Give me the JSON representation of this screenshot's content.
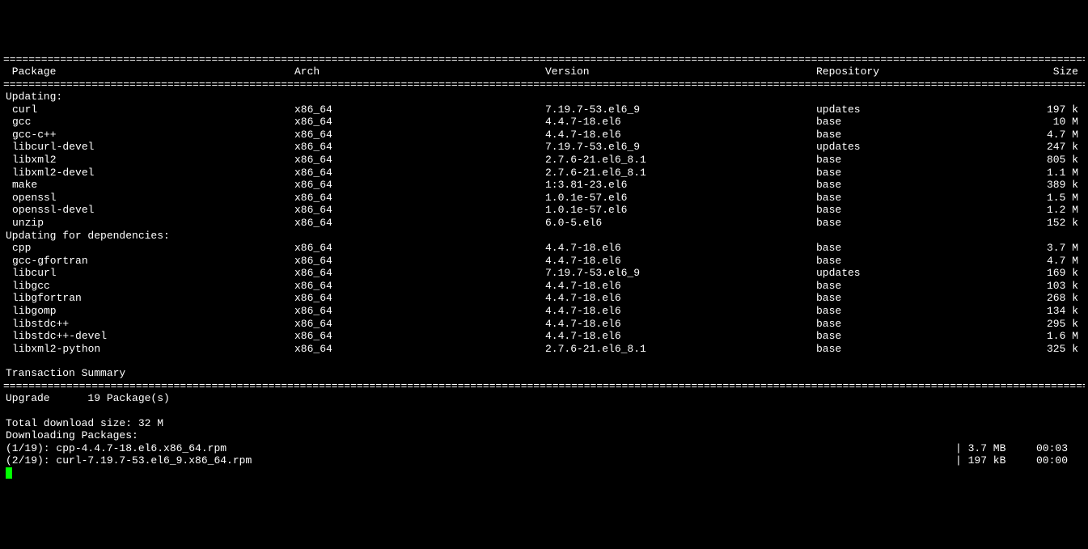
{
  "headers": {
    "package": "Package",
    "arch": "Arch",
    "version": "Version",
    "repository": "Repository",
    "size": "Size"
  },
  "sections": [
    {
      "label": "Updating:",
      "rows": [
        {
          "package": "curl",
          "arch": "x86_64",
          "version": "7.19.7-53.el6_9",
          "repo": "updates",
          "size": "197 k"
        },
        {
          "package": "gcc",
          "arch": "x86_64",
          "version": "4.4.7-18.el6",
          "repo": "base",
          "size": "10 M"
        },
        {
          "package": "gcc-c++",
          "arch": "x86_64",
          "version": "4.4.7-18.el6",
          "repo": "base",
          "size": "4.7 M"
        },
        {
          "package": "libcurl-devel",
          "arch": "x86_64",
          "version": "7.19.7-53.el6_9",
          "repo": "updates",
          "size": "247 k"
        },
        {
          "package": "libxml2",
          "arch": "x86_64",
          "version": "2.7.6-21.el6_8.1",
          "repo": "base",
          "size": "805 k"
        },
        {
          "package": "libxml2-devel",
          "arch": "x86_64",
          "version": "2.7.6-21.el6_8.1",
          "repo": "base",
          "size": "1.1 M"
        },
        {
          "package": "make",
          "arch": "x86_64",
          "version": "1:3.81-23.el6",
          "repo": "base",
          "size": "389 k"
        },
        {
          "package": "openssl",
          "arch": "x86_64",
          "version": "1.0.1e-57.el6",
          "repo": "base",
          "size": "1.5 M"
        },
        {
          "package": "openssl-devel",
          "arch": "x86_64",
          "version": "1.0.1e-57.el6",
          "repo": "base",
          "size": "1.2 M"
        },
        {
          "package": "unzip",
          "arch": "x86_64",
          "version": "6.0-5.el6",
          "repo": "base",
          "size": "152 k"
        }
      ]
    },
    {
      "label": "Updating for dependencies:",
      "rows": [
        {
          "package": "cpp",
          "arch": "x86_64",
          "version": "4.4.7-18.el6",
          "repo": "base",
          "size": "3.7 M"
        },
        {
          "package": "gcc-gfortran",
          "arch": "x86_64",
          "version": "4.4.7-18.el6",
          "repo": "base",
          "size": "4.7 M"
        },
        {
          "package": "libcurl",
          "arch": "x86_64",
          "version": "7.19.7-53.el6_9",
          "repo": "updates",
          "size": "169 k"
        },
        {
          "package": "libgcc",
          "arch": "x86_64",
          "version": "4.4.7-18.el6",
          "repo": "base",
          "size": "103 k"
        },
        {
          "package": "libgfortran",
          "arch": "x86_64",
          "version": "4.4.7-18.el6",
          "repo": "base",
          "size": "268 k"
        },
        {
          "package": "libgomp",
          "arch": "x86_64",
          "version": "4.4.7-18.el6",
          "repo": "base",
          "size": "134 k"
        },
        {
          "package": "libstdc++",
          "arch": "x86_64",
          "version": "4.4.7-18.el6",
          "repo": "base",
          "size": "295 k"
        },
        {
          "package": "libstdc++-devel",
          "arch": "x86_64",
          "version": "4.4.7-18.el6",
          "repo": "base",
          "size": "1.6 M"
        },
        {
          "package": "libxml2-python",
          "arch": "x86_64",
          "version": "2.7.6-21.el6_8.1",
          "repo": "base",
          "size": "325 k"
        }
      ]
    }
  ],
  "summary": {
    "title": "Transaction Summary",
    "upgrade_label": "Upgrade",
    "upgrade_count": "19 Package(s)",
    "total_download": "Total download size: 32 M",
    "downloading": "Downloading Packages:"
  },
  "downloads": [
    {
      "line": "(1/19): cpp-4.4.7-18.el6.x86_64.rpm",
      "size": "| 3.7 MB",
      "time": "00:03"
    },
    {
      "line": "(2/19): curl-7.19.7-53.el6_9.x86_64.rpm",
      "size": "| 197 kB",
      "time": "00:00"
    }
  ]
}
